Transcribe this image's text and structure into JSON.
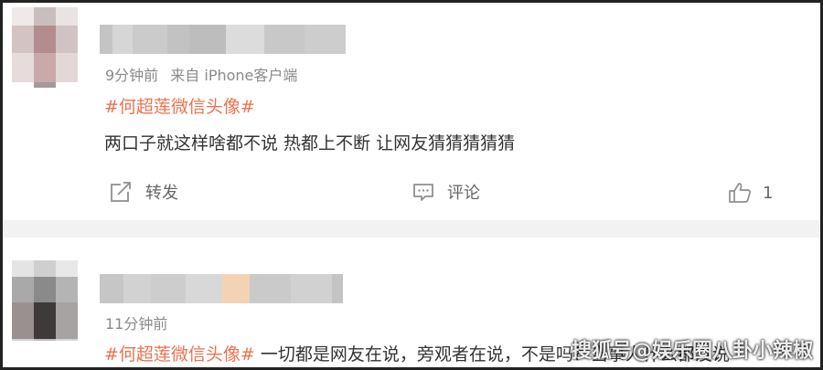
{
  "posts": [
    {
      "timestamp": "9分钟前",
      "source": "来自 iPhone客户端",
      "hashtag": "#何超莲微信头像#",
      "content": "两口子就这样啥都不说 热都上不断 让网友猜猜猜猜猜",
      "actions": {
        "repost_label": "转发",
        "comment_label": "评论",
        "like_count": "1"
      }
    },
    {
      "timestamp": "11分钟前",
      "hashtag": "#何超莲微信头像#",
      "content": "一切都是网友在说，旁观者在说，不是吗？当事人什么都没说"
    }
  ],
  "watermark": "搜狐号@娱乐圈八卦小辣椒"
}
